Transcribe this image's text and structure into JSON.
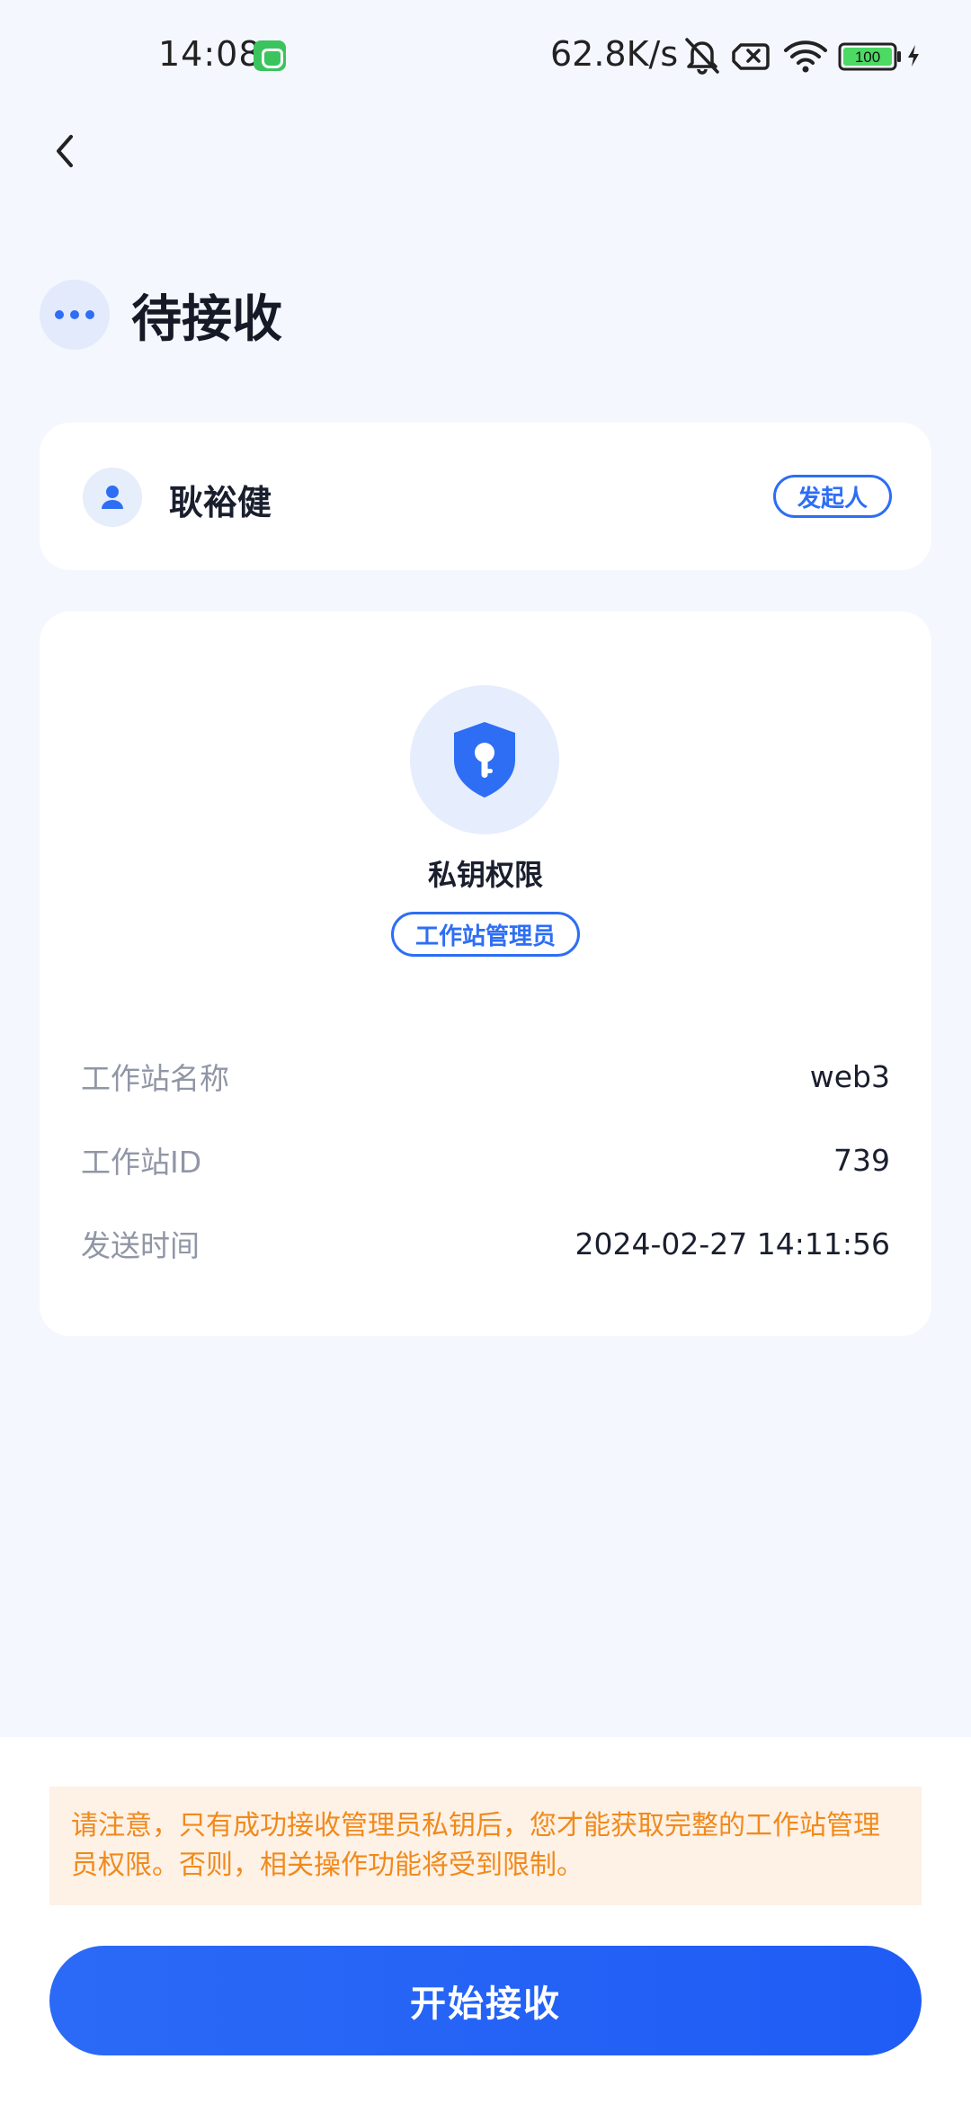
{
  "status_bar": {
    "time": "14:08",
    "network_speed": "62.8K/s",
    "battery": "100",
    "icons": [
      "app-notification-icon",
      "mute-bell-icon",
      "sim-off-icon",
      "wifi-icon",
      "battery-icon",
      "charging-icon"
    ]
  },
  "header": {
    "back_icon": "chevron-left-icon",
    "status_icon": "more-dots-icon",
    "title": "待接收"
  },
  "initiator": {
    "name": "耿裕健",
    "role_label": "发起人",
    "icon": "person-icon"
  },
  "permission": {
    "icon": "shield-key-icon",
    "title": "私钥权限",
    "role_tag": "工作站管理员"
  },
  "details": [
    {
      "label": "工作站名称",
      "value": "web3"
    },
    {
      "label": "工作站ID",
      "value": "739"
    },
    {
      "label": "发送时间",
      "value": "2024-02-27 14:11:56"
    }
  ],
  "notice": {
    "text": "请注意，只有成功接收管理员私钥后，您才能获取完整的工作站管理员权限。否则，相关操作功能将受到限制。"
  },
  "actions": {
    "primary_label": "开始接收"
  },
  "colors": {
    "accent": "#2d6ef5",
    "background": "#f4f7fe",
    "notice_bg": "#fef1e6",
    "notice_text": "#f08a1c",
    "battery_fill": "#4cd964"
  }
}
